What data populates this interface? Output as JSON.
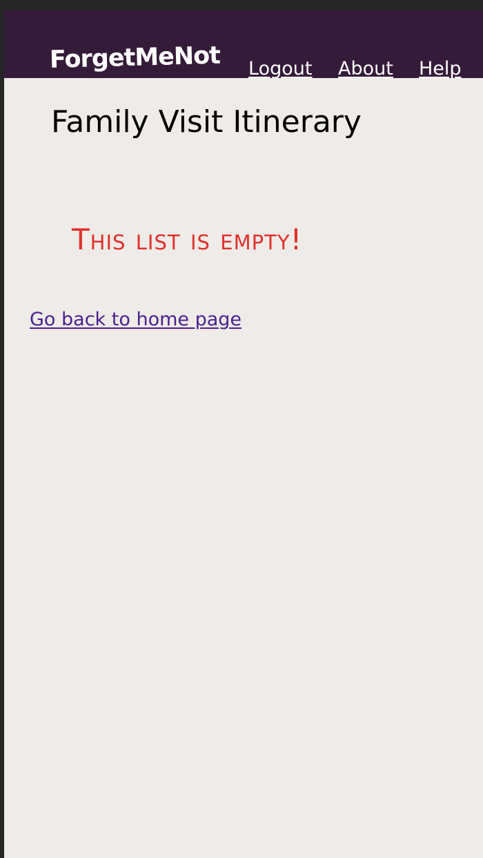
{
  "app": {
    "brand": "ForgetMeNot"
  },
  "nav": {
    "logout": "Logout",
    "about": "About",
    "help": "Help"
  },
  "main": {
    "title": "Family Visit Itinerary",
    "empty_message": "This list is empty!",
    "back_link": "Go back to home page"
  },
  "colors": {
    "header_bg": "#351b3a",
    "page_bg": "#eeebe8",
    "empty_message": "#e0302a",
    "link": "#4a2090"
  }
}
